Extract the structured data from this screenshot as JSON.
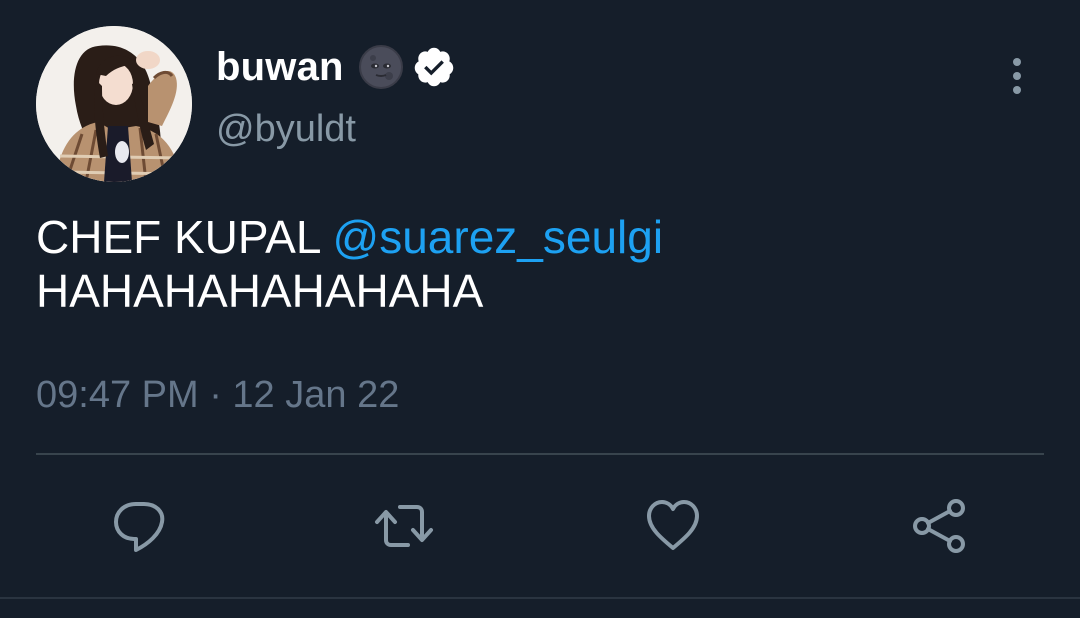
{
  "user": {
    "display_name": "buwan",
    "handle": "@byuldt",
    "name_emoji": "new-moon-face-emoji",
    "verified": true
  },
  "tweet": {
    "text_part1": "CHEF KUPAL ",
    "mention": "@suarez_seulgi",
    "text_part2": "HAHAHAHAHAHAHA",
    "timestamp": "09:47 PM · 12 Jan 22"
  },
  "actions": [
    "reply-icon",
    "retweet-icon",
    "like-icon",
    "share-icon"
  ],
  "colors": {
    "background": "#151e2a",
    "text": "#ffffff",
    "secondary": "#8899a6",
    "mention": "#1da1f2",
    "verified_badge": "#ffffff",
    "divider": "#38444d"
  }
}
